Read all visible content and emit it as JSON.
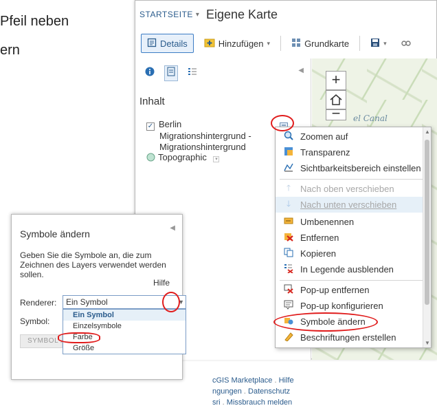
{
  "document_text": {
    "line1": "Pfeil neben",
    "line2": "ern"
  },
  "header": {
    "home_label": "STARTSEITE",
    "home_caret": "▾",
    "map_title": "Eigene Karte"
  },
  "toolbar": {
    "details_label": "Details",
    "add_label": "Hinzufügen",
    "add_caret": "▾",
    "basemap_label": "Grundkarte",
    "save_caret": "▾"
  },
  "content": {
    "heading": "Inhalt",
    "layer_1": {
      "checked": true,
      "line1": "Berlin",
      "line2": "Migrationshintergrund -",
      "line3": "Migrationshintergrund"
    },
    "layer_2": {
      "label": "Topographic"
    }
  },
  "map": {
    "canal_label": "el Canal"
  },
  "context_menu": {
    "items": [
      {
        "label": "Zoomen auf",
        "icon": "zoom-icon"
      },
      {
        "label": "Transparenz",
        "icon": "transparency-icon"
      },
      {
        "label": "Sichtbarkeitsbereich einstellen",
        "icon": "visibility-range-icon"
      },
      {
        "label": "Nach oben verschieben",
        "icon": "arrow-up-icon",
        "disabled": true
      },
      {
        "label": "Nach unten verschieben",
        "icon": "arrow-down-icon",
        "disabled": true,
        "hover": true
      },
      {
        "label": "Umbenennen",
        "icon": "rename-icon"
      },
      {
        "label": "Entfernen",
        "icon": "remove-icon"
      },
      {
        "label": "Kopieren",
        "icon": "copy-icon"
      },
      {
        "label": "In Legende ausblenden",
        "icon": "hide-legend-icon"
      },
      {
        "label": "Pop-up entfernen",
        "icon": "popup-remove-icon"
      },
      {
        "label": "Pop-up konfigurieren",
        "icon": "popup-config-icon"
      },
      {
        "label": "Symbole ändern",
        "icon": "change-symbols-icon"
      },
      {
        "label": "Beschriftungen erstellen",
        "icon": "labels-icon"
      }
    ]
  },
  "footer_links": {
    "line1_a": "cGIS Marketplace",
    "line1_sep": ".",
    "line1_b": "Hilfe",
    "line2_a": "ngungen",
    "line2_sep": ".",
    "line2_b": "Datenschutz",
    "line3_a": "sri",
    "line3_sep": ".",
    "line3_b": "Missbrauch melden"
  },
  "symbol_panel": {
    "title": "Symbole ändern",
    "description": "Geben Sie die Symbole an, die zum Zeichnen des Layers verwendet werden sollen.",
    "help": "Hilfe",
    "renderer_label": "Renderer:",
    "renderer_value": "Ein Symbol",
    "renderer_options": [
      "Ein Symbol",
      "Einzelsymbole",
      "Farbe",
      "Größe"
    ],
    "renderer_selected_index": 0,
    "symbol_label": "Symbol:",
    "symbol_button": "SYMBOL Ä"
  },
  "colors": {
    "accent": "#2a5b8c",
    "annotation_red": "#e01b1b",
    "hover_bg": "#e6f0f8"
  }
}
